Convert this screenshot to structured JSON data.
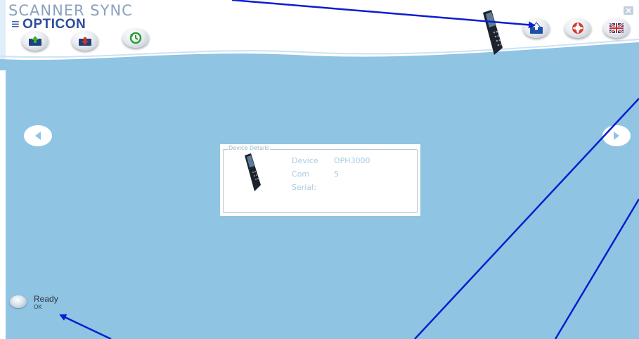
{
  "app": {
    "title": "SCANNER SYNC",
    "brand": "OPTICON",
    "brand_icon": "menu-lines-icon"
  },
  "toolbar_left": [
    {
      "name": "upload-to-scanner-button",
      "icon": "green-up-arrow-icon"
    },
    {
      "name": "download-from-scanner-button",
      "icon": "red-down-arrow-icon"
    },
    {
      "name": "sync-history-button",
      "icon": "green-clock-refresh-icon"
    }
  ],
  "toolbar_right": [
    {
      "name": "export-button",
      "icon": "blue-export-icon"
    },
    {
      "name": "help-button",
      "icon": "lifebuoy-icon"
    },
    {
      "name": "language-button",
      "icon": "uk-flag-icon"
    }
  ],
  "device_card": {
    "legend": "Device Details",
    "device_label": "Device",
    "device_value": "OPH3000",
    "com_label": "Com",
    "com_value": "5",
    "serial_label": "Serial:",
    "serial_value": ""
  },
  "status": {
    "text": "Ready",
    "subtext": "OK"
  },
  "colors": {
    "main_background": "#8fc4e3",
    "brand_blue": "#2a4d9c",
    "annotation_line": "#0a1ecf"
  }
}
